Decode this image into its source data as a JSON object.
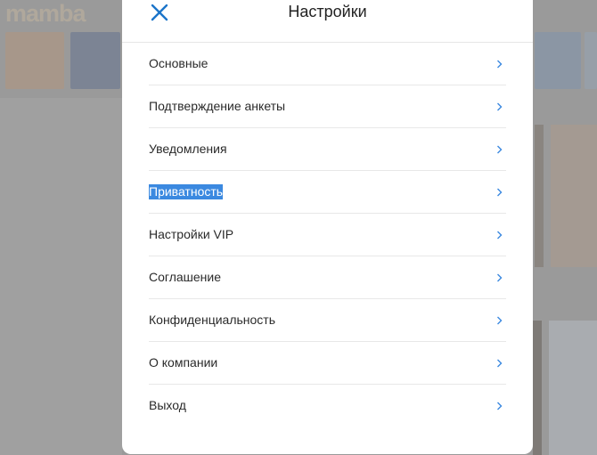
{
  "background": {
    "logo_text": "mamba"
  },
  "modal": {
    "title": "Настройки",
    "close_icon": "close-icon",
    "accent_color": "#1b74c9",
    "selected_color": "#3b89e0",
    "items": [
      {
        "label": "Основные"
      },
      {
        "label": "Подтверждение анкеты"
      },
      {
        "label": "Уведомления"
      },
      {
        "label": "Приватность",
        "selected": true
      },
      {
        "label": "Настройки VIP"
      },
      {
        "label": "Соглашение"
      },
      {
        "label": "Конфиденциальность"
      },
      {
        "label": "О компании"
      },
      {
        "label": "Выход"
      }
    ]
  }
}
